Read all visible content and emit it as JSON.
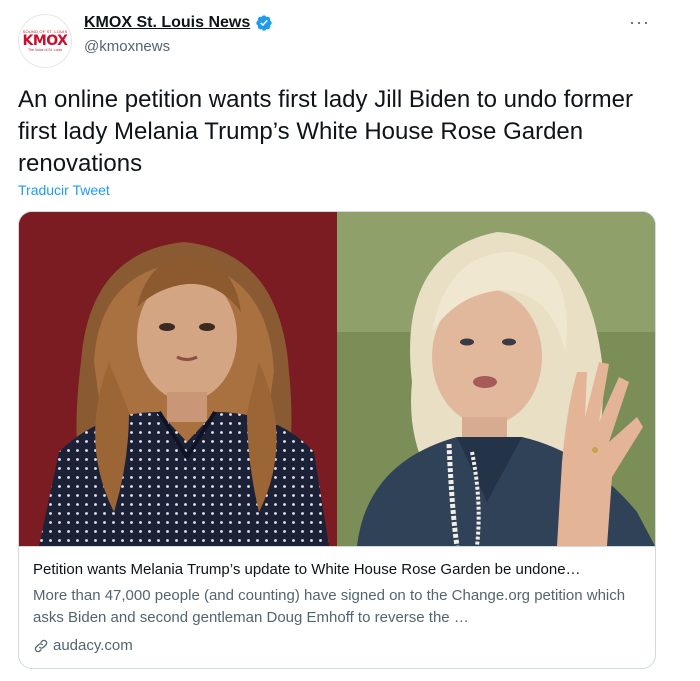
{
  "account": {
    "display_name": "KMOX St. Louis News",
    "handle": "@kmoxnews",
    "avatar_text": "KMOX",
    "avatar_small_top": "SOUND OF ST. LOUIS",
    "avatar_small_bottom": "The Voice of St. Louis"
  },
  "tweet": {
    "text": "An online petition wants first lady Jill Biden to undo former first lady Melania Trump’s White House Rose Garden renovations",
    "translate_label": "Traducir Tweet"
  },
  "card": {
    "title": "Petition wants Melania Trump’s update to White House Rose Garden be undone…",
    "description": "More than 47,000 people (and counting) have signed on to the Change.org petition which asks Biden and second gentleman Doug Emhoff to reverse the …",
    "domain": "audacy.com"
  },
  "icons": {
    "verified": "verified-badge-icon",
    "more": "more-options-icon",
    "link": "link-icon"
  },
  "colors": {
    "accent": "#1d9bf0",
    "secondary_text": "#536471",
    "border": "#cfd9de",
    "brand_red": "#c8102e"
  }
}
